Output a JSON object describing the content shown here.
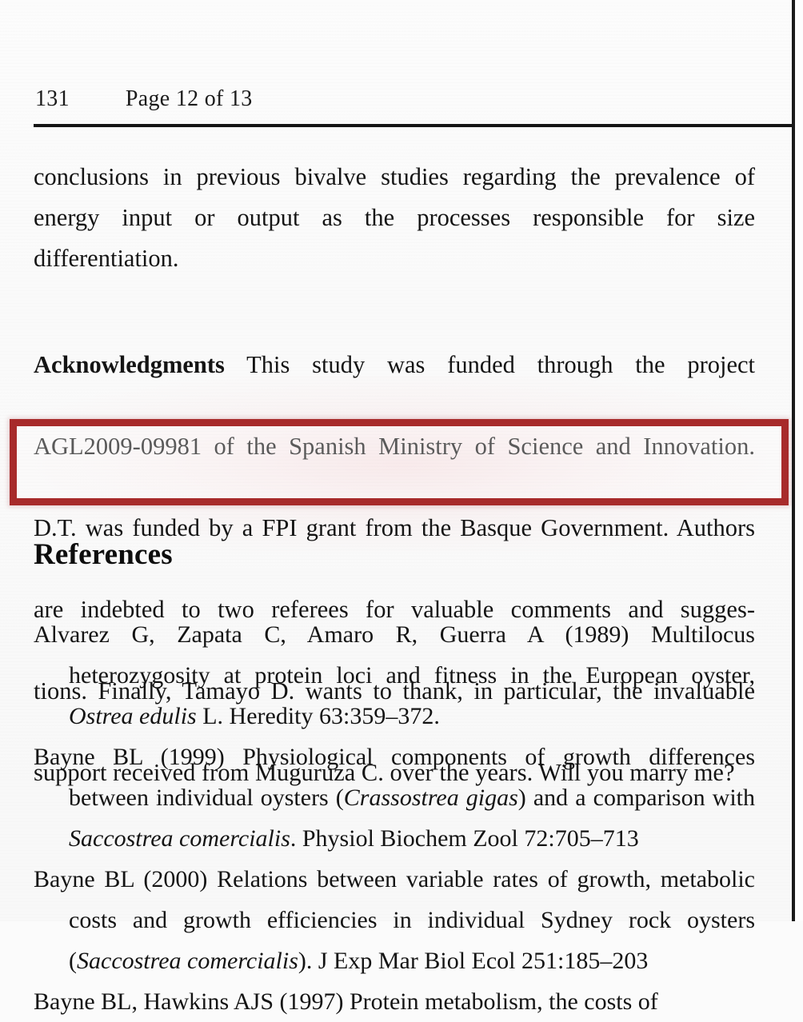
{
  "document": {
    "type": "scanned-journal-page",
    "background_color": "#fbfbfb",
    "text_color": "#141414"
  },
  "header": {
    "folio": "131",
    "page_of": "Page 12 of 13"
  },
  "body": {
    "paragraph_1": "conclusions in previous bivalve studies regarding the prevalence of energy input or output as the processes responsible for size differentiation.",
    "acknowledgments": {
      "label": "Acknowledgments",
      "line_1": "This study was funded through the project",
      "line_2": "AGL2009-09981 of the Spanish Ministry of Science and Innovation.",
      "line_3": "D.T. was funded by a FPI grant from the Basque Government. Authors",
      "line_4": "are indebted to two referees for valuable comments and sugges-",
      "line_5": "tions. Finally, Tamayo D. wants to thank, in particular, the invaluable",
      "line_6": "support received from Muguruza C. over the years. Will you marry me?"
    }
  },
  "highlight": {
    "border_color": "#a82b2b",
    "border_width_px": 9,
    "covers_lines": [
      "tions. Finally, Tamayo D. wants to thank, in particular, the invaluable",
      "support received from Muguruza C. over the years. Will you marry me?"
    ]
  },
  "references": {
    "heading": "References",
    "entries": [
      {
        "authors_year": "Alvarez G, Zapata C, Amaro R, Guerra A (1989)",
        "title_part_1": " Multilocus heterozygosity at protein loci and fitness in the European oyster, ",
        "italic_1": "Ostrea edulis",
        "title_part_2": " L. Heredity 63:359–372."
      },
      {
        "authors_year": "Bayne BL (1999)",
        "title_part_1": " Physiological components of growth differences between individual oysters (",
        "italic_1": "Crassostrea gigas",
        "title_part_2": ") and a comparison with ",
        "italic_2": "Saccostrea comercialis",
        "title_part_3": ". Physiol Biochem Zool 72:705–713"
      },
      {
        "authors_year": "Bayne BL (2000)",
        "title_part_1": " Relations between variable rates of growth, metabolic costs and growth efficiencies in individual Sydney rock oysters (",
        "italic_1": "Saccostrea comercialis",
        "title_part_2": "). J Exp Mar Biol Ecol 251:185–203"
      },
      {
        "authors_year": "Bayne BL, Hawkins AJS (1997)",
        "title_part_1": " Protein metabolism, the costs of",
        "italic_1": "",
        "title_part_2": ""
      }
    ]
  }
}
